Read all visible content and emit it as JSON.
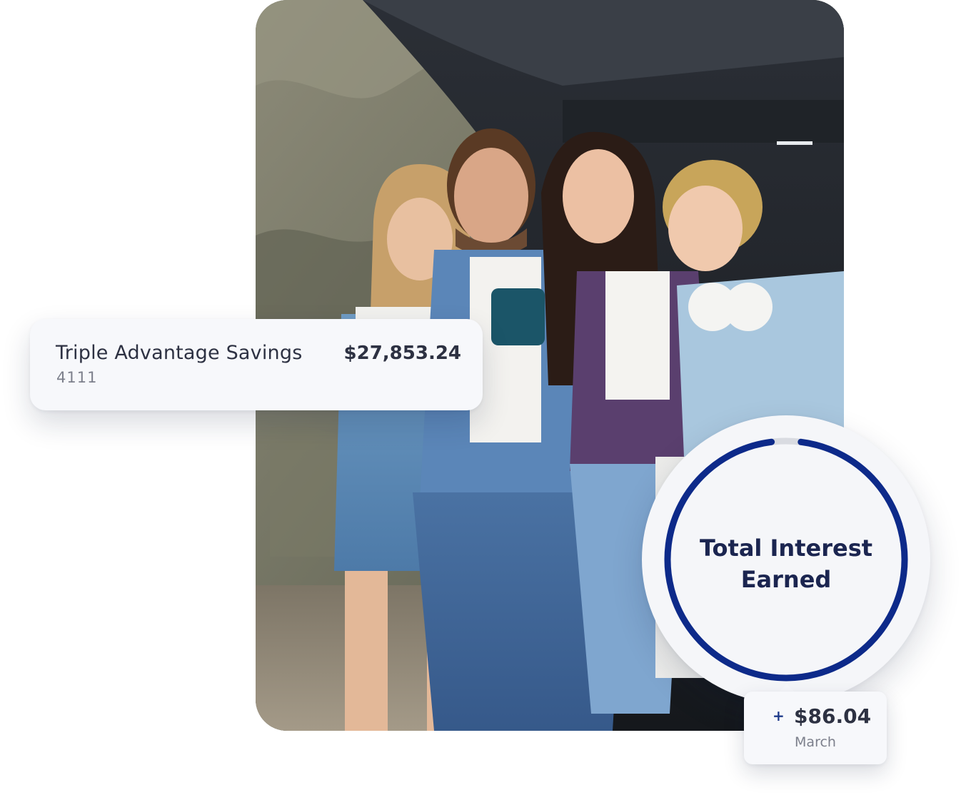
{
  "account": {
    "name": "Triple Advantage Savings",
    "number": "4111",
    "balance": "$27,853.24"
  },
  "interest": {
    "title_line1": "Total Interest",
    "title_line2": "Earned",
    "progress_fraction": 0.96,
    "ring_color": "#0d2a8a",
    "track_color": "#d9dbe1"
  },
  "summary": {
    "plus_symbol": "+",
    "amount": "$86.04",
    "month": "March"
  },
  "photo": {
    "description_icon": "family-photo"
  }
}
